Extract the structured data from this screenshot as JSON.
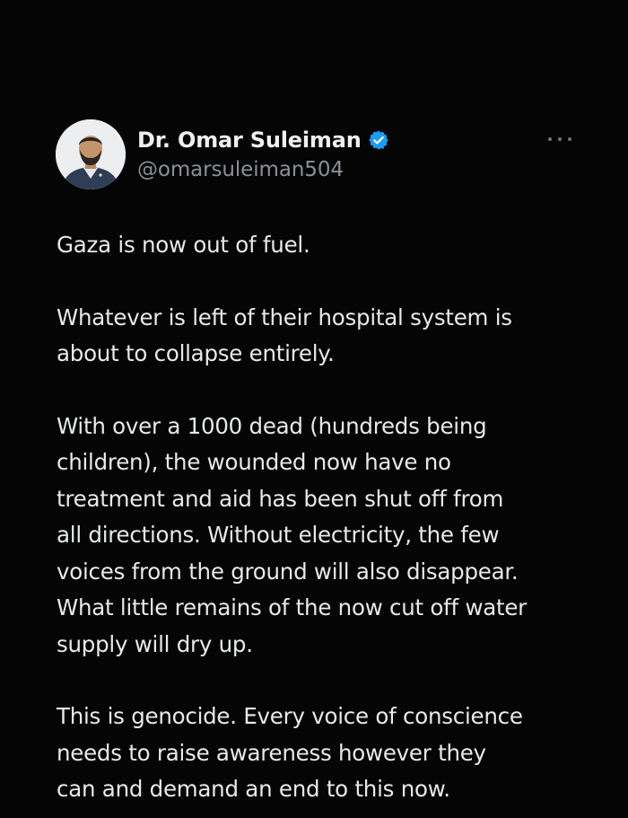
{
  "tweet": {
    "author": {
      "display_name": "Dr. Omar Suleiman",
      "handle": "@omarsuleiman504",
      "verified": true,
      "avatar_icon": "profile-photo",
      "verified_icon": "verified-badge-icon"
    },
    "more_icon": "more-options-icon",
    "paragraphs": [
      "Gaza is now out of fuel.",
      "Whatever is left of their hospital system is\nabout to collapse entirely.",
      "With over a 1000 dead (hundreds being\nchildren), the wounded now have no\ntreatment and aid has been shut off from\nall directions. Without electricity, the few\nvoices from the ground will also disappear.\nWhat little remains of the now cut off water\nsupply will dry up.",
      "This is genocide. Every voice of conscience\nneeds to raise awareness however they\ncan and demand an end to this now."
    ]
  },
  "colors": {
    "background": "#050505",
    "text": "#e7e9ea",
    "secondary_text": "#8b9096",
    "verified_blue": "#1d9bf0"
  }
}
